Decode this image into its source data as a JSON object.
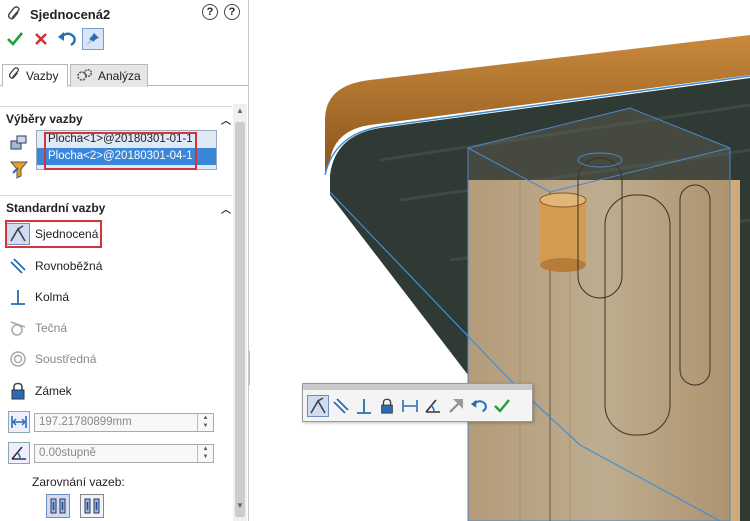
{
  "header": {
    "title": "Sjednocená2",
    "help_icon": "help-icon",
    "whatsnew_icon": "whats-new-icon"
  },
  "tabs": [
    {
      "label": "Vazby",
      "icon": "paperclip-icon",
      "active": true
    },
    {
      "label": "Analýza",
      "icon": "gears-icon",
      "active": false
    }
  ],
  "mate_selections": {
    "heading": "Výběry vazby",
    "items": [
      "Plocha<1>@20180301-01-1",
      "Plocha<2>@20180301-04-1"
    ],
    "selected_index": 1
  },
  "standard_mates": {
    "heading": "Standardní vazby",
    "items": [
      {
        "label": "Sjednocená",
        "icon": "coincident-icon",
        "selected": true,
        "enabled": true
      },
      {
        "label": "Rovnoběžná",
        "icon": "parallel-icon",
        "selected": false,
        "enabled": true
      },
      {
        "label": "Kolmá",
        "icon": "perpendicular-icon",
        "selected": false,
        "enabled": true
      },
      {
        "label": "Tečná",
        "icon": "tangent-icon",
        "selected": false,
        "enabled": false
      },
      {
        "label": "Soustředná",
        "icon": "concentric-icon",
        "selected": false,
        "enabled": false
      },
      {
        "label": "Zámek",
        "icon": "lock-icon",
        "selected": false,
        "enabled": true
      }
    ],
    "distance_value": "197.21780899mm",
    "angle_value": "0.00stupně",
    "alignment_label": "Zarovnání vazeb:"
  },
  "colors": {
    "accent_blue": "#3a86d9",
    "highlight_red": "#d4333b",
    "ok_green": "#1f9d3a",
    "cancel_red": "#d32f2f"
  }
}
